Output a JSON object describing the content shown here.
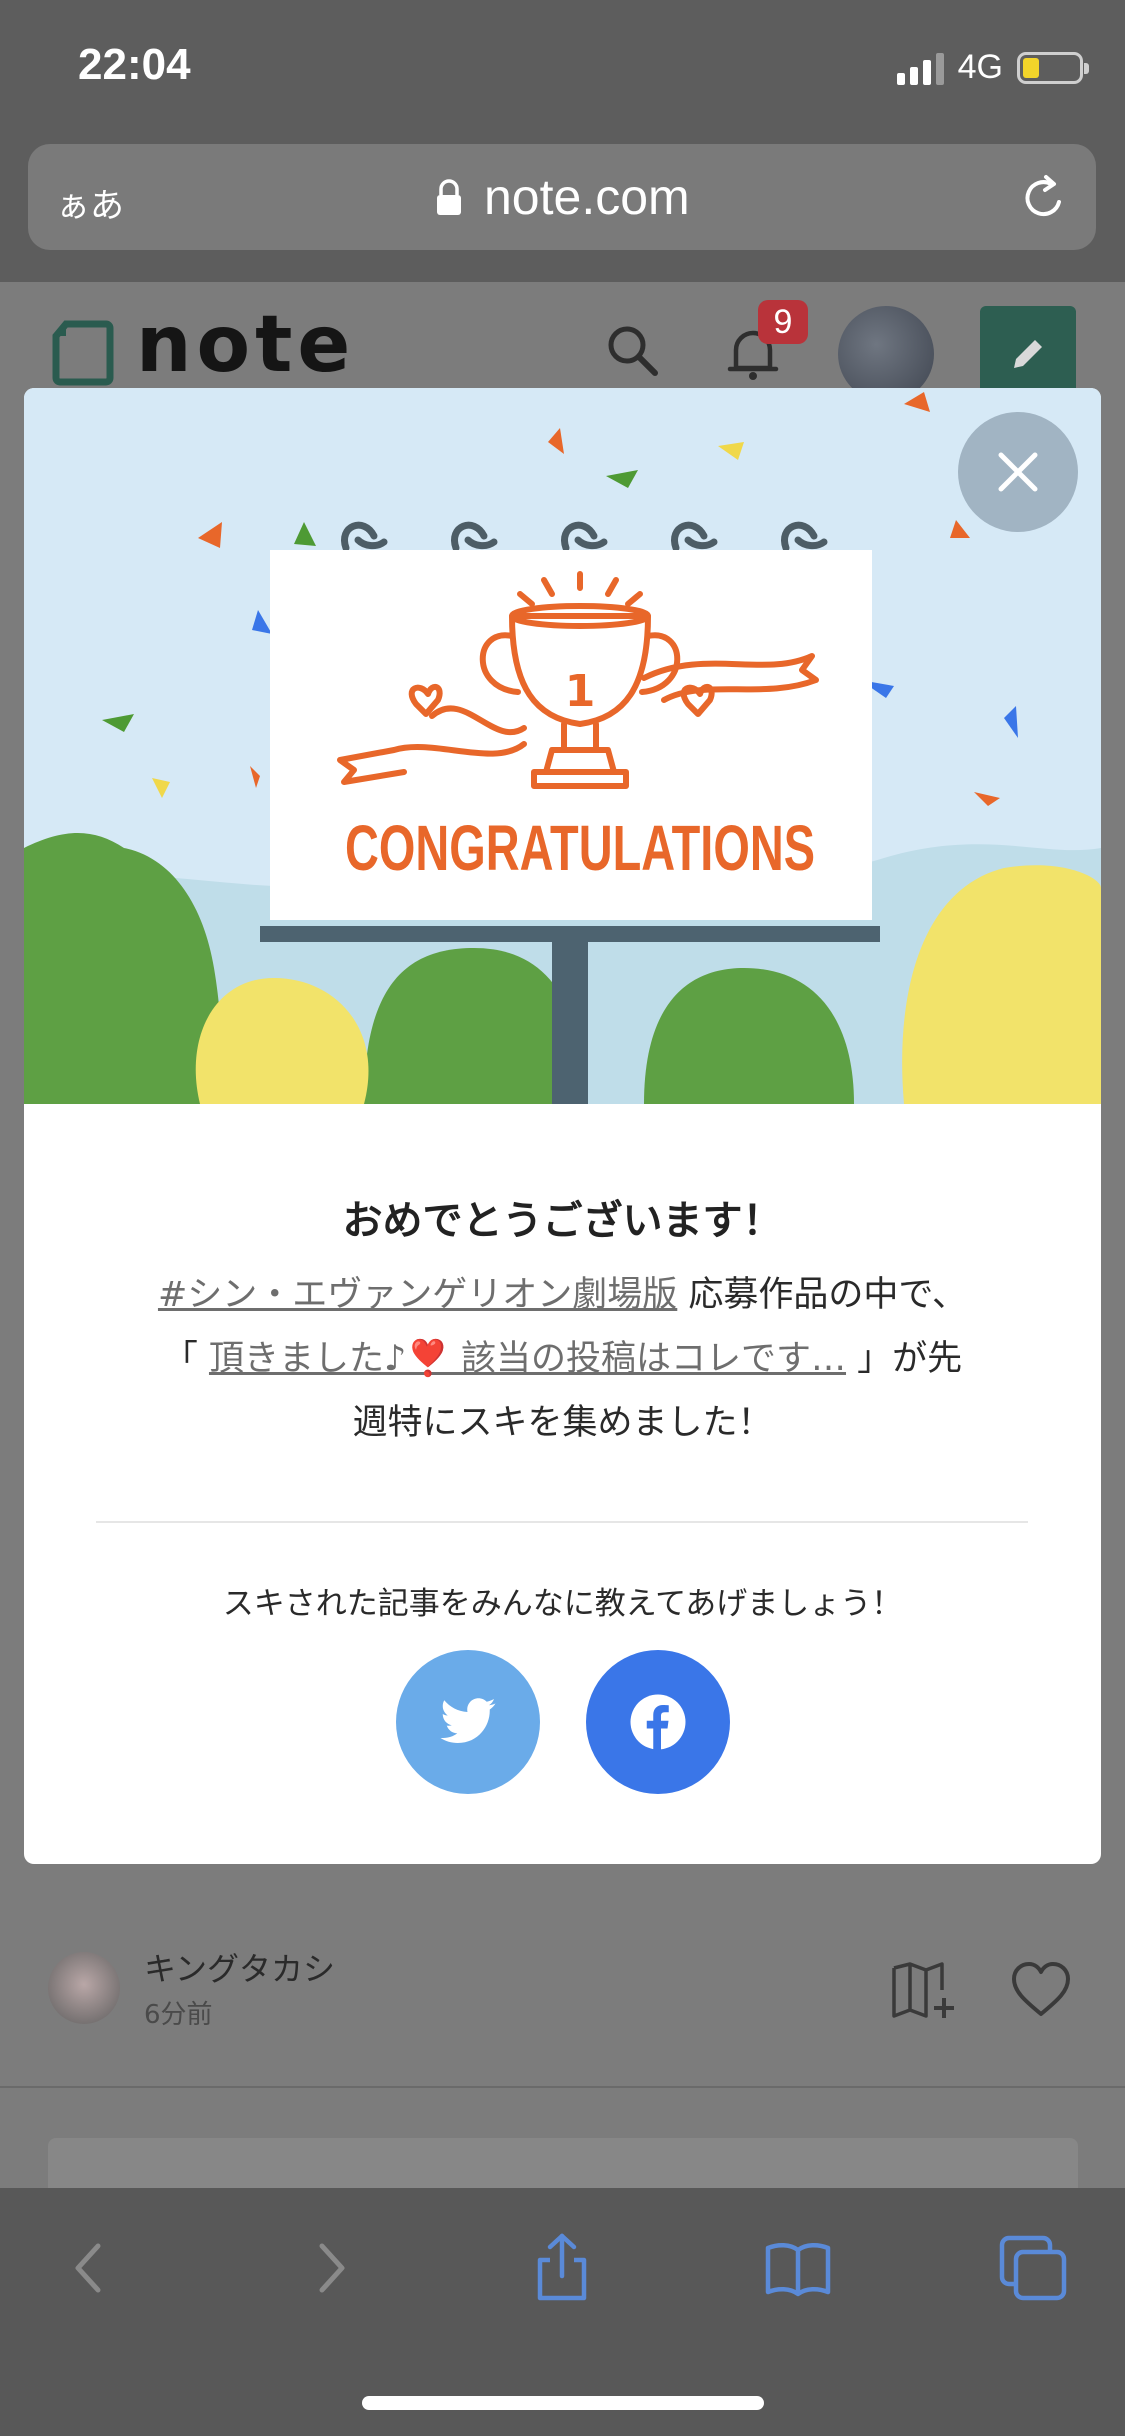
{
  "status_bar": {
    "time": "22:04",
    "network": "4G"
  },
  "browser": {
    "aa_label": "ぁあ",
    "url": "note.com"
  },
  "header": {
    "logo_text": "note",
    "notification_count": "9"
  },
  "modal": {
    "title": "おめでとうございます！",
    "message": {
      "hashtag_link": "#シン・エヴァンゲリオン劇場版",
      "after_hashtag": "応募作品の中で、",
      "quote_open": "「",
      "article_link": "頂きました♪❣️ 該当の投稿はコレです…",
      "quote_close": "」が先",
      "line3": "週特にスキを集めました！"
    },
    "banner_text": "CONGRATULATIONS",
    "trophy_number": "1",
    "share_prompt": "スキされた記事をみんなに教えてあげましょう！",
    "share_buttons": [
      "twitter-icon",
      "facebook-icon"
    ]
  },
  "feed": {
    "author_name": "キングタカシ",
    "post_time": "6分前"
  },
  "colors": {
    "brand_green": "#2d5e51",
    "twitter_blue": "#6aabe9",
    "facebook_blue": "#3a76e8",
    "badge_red": "#b9333a",
    "congrats_orange": "#e8672a"
  }
}
